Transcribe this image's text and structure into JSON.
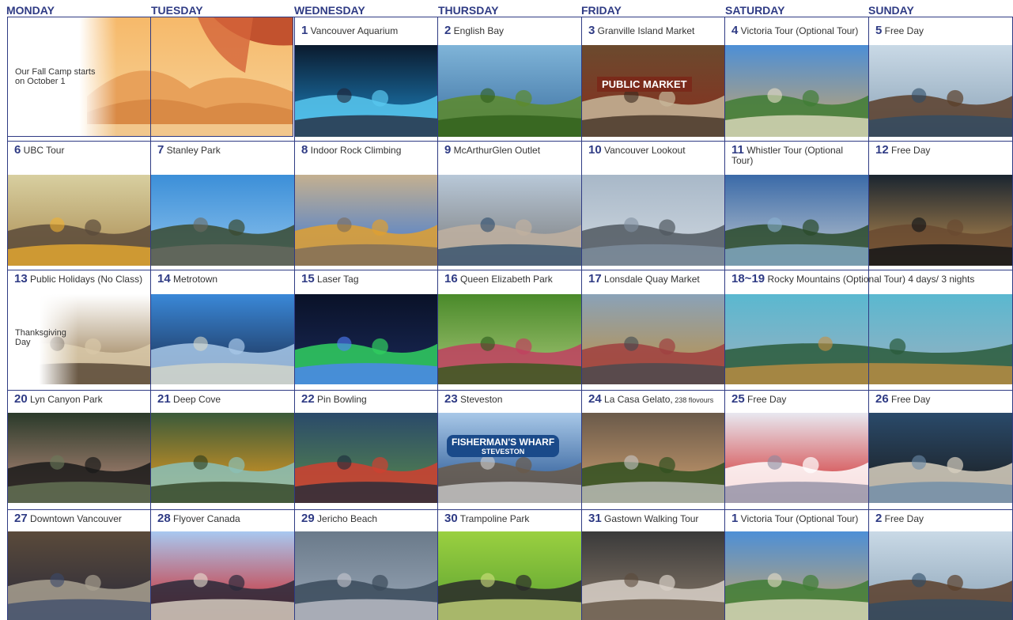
{
  "days": [
    "MONDAY",
    "TUESDAY",
    "WEDNESDAY",
    "THURSDAY",
    "FRIDAY",
    "SATURDAY",
    "SUNDAY"
  ],
  "notes": {
    "camp": "Our Fall Camp starts on October 1",
    "thanksgiving": "Thanksgiving Day"
  },
  "weeks": [
    [
      null,
      null,
      {
        "num": "1",
        "title": "Vancouver Aquarium",
        "photo": "aquarium"
      },
      {
        "num": "2",
        "title": "English Bay",
        "photo": "beach-park"
      },
      {
        "num": "3",
        "title": "Granville Island Market",
        "photo": "public-market"
      },
      {
        "num": "4",
        "title": "Victoria Tour (Optional Tour)",
        "photo": "parliament"
      },
      {
        "num": "5",
        "title": "Free Day",
        "photo": "marina"
      }
    ],
    [
      {
        "num": "6",
        "title": "UBC Tour",
        "photo": "campus-walk"
      },
      {
        "num": "7",
        "title": "Stanley Park",
        "photo": "seawall"
      },
      {
        "num": "8",
        "title": "Indoor Rock Climbing",
        "photo": "climbing-wall"
      },
      {
        "num": "9",
        "title": "McArthurGlen Outlet",
        "photo": "outlet"
      },
      {
        "num": "10",
        "title": "Vancouver Lookout",
        "photo": "lookout"
      },
      {
        "num": "11",
        "title": "Whistler Tour (Optional Tour)",
        "photo": "olympic-rings"
      },
      {
        "num": "12",
        "title": "Free Day",
        "photo": "bridge-night"
      }
    ],
    [
      {
        "num": "13",
        "title": "Public Holidays (No Class)",
        "photo": "thanksgiving-food"
      },
      {
        "num": "14",
        "title": "Metrotown",
        "photo": "metrotown"
      },
      {
        "num": "15",
        "title": "Laser Tag",
        "photo": "laser-sky"
      },
      {
        "num": "16",
        "title": "Queen Elizabeth Park",
        "photo": "garden"
      },
      {
        "num": "17",
        "title": "Lonsdale Quay Market",
        "photo": "love-locks"
      },
      {
        "num": "18~19",
        "title": "Rocky Mountains (Optional Tour) 4 days/ 3 nights",
        "photo": "lake-mountains"
      },
      null
    ],
    [
      {
        "num": "20",
        "title": "Lyn Canyon Park",
        "photo": "canyon-girls"
      },
      {
        "num": "21",
        "title": "Deep Cove",
        "photo": "deep-cove"
      },
      {
        "num": "22",
        "title": "Pin Bowling",
        "photo": "bowling"
      },
      {
        "num": "23",
        "title": "Steveston",
        "photo": "fishermans-wharf"
      },
      {
        "num": "24",
        "title": "La Casa Gelato,",
        "small": "238 flovours",
        "photo": "gelato"
      },
      {
        "num": "25",
        "title": "Free Day",
        "photo": "canada-flag"
      },
      {
        "num": "26",
        "title": "Free Day",
        "photo": "orca-statue"
      }
    ],
    [
      {
        "num": "27",
        "title": "Downtown Vancouver",
        "photo": "group-steps"
      },
      {
        "num": "28",
        "title": "Flyover Canada",
        "photo": "flyover-group"
      },
      {
        "num": "29",
        "title": "Jericho Beach",
        "photo": "jericho"
      },
      {
        "num": "30",
        "title": "Trampoline Park",
        "photo": "trampoline"
      },
      {
        "num": "31",
        "title": "Gastown Walking Tour",
        "photo": "steam-clock"
      },
      {
        "num": "1",
        "title": "Victoria Tour (Optional Tour)",
        "photo": "parliament"
      },
      {
        "num": "2",
        "title": "Free Day",
        "photo": "marina"
      }
    ]
  ],
  "banner": {
    "sign_text": "PUBLIC MARKET"
  },
  "wharf": {
    "sign_text": "FISHERMAN'S WHARF",
    "sub_text": "STEVESTON"
  }
}
